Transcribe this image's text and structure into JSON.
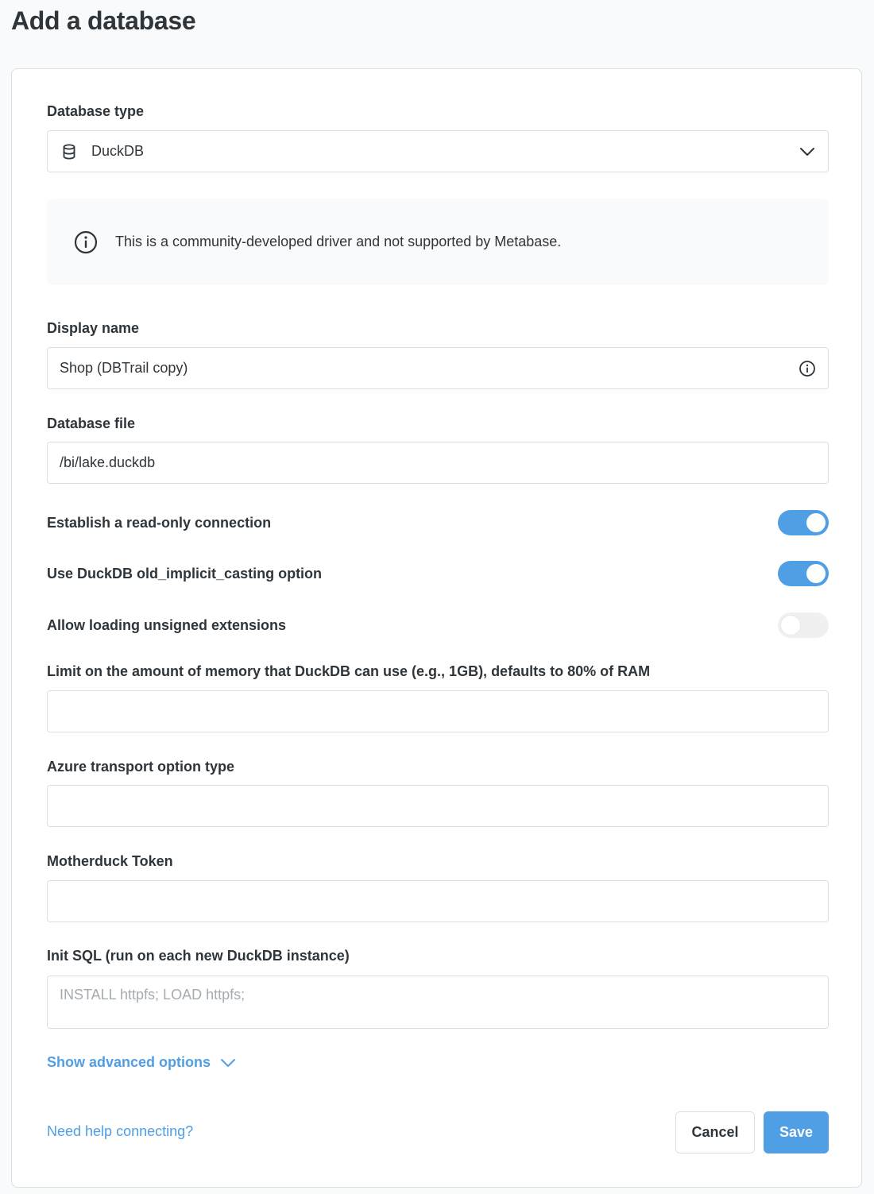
{
  "page": {
    "title": "Add a database"
  },
  "colors": {
    "accent": "#509ee3",
    "border": "#dcdfe0",
    "text": "#2e353b",
    "placeholder": "#a5acb1"
  },
  "form": {
    "database_type": {
      "label": "Database type",
      "value": "DuckDB",
      "icon": "database-icon"
    },
    "notice": {
      "text": "This is a community-developed driver and not supported by Metabase.",
      "icon": "info-icon"
    },
    "display_name": {
      "label": "Display name",
      "value": "Shop (DBTrail copy)"
    },
    "database_file": {
      "label": "Database file",
      "value": "/bi/lake.duckdb"
    },
    "toggles": [
      {
        "label": "Establish a read-only connection",
        "on": true
      },
      {
        "label": "Use DuckDB old_implicit_casting option",
        "on": true
      },
      {
        "label": "Allow loading unsigned extensions",
        "on": false
      }
    ],
    "memory_limit": {
      "label": "Limit on the amount of memory that DuckDB can use (e.g., 1GB), defaults to 80% of RAM",
      "value": ""
    },
    "azure_transport": {
      "label": "Azure transport option type",
      "value": ""
    },
    "motherduck_token": {
      "label": "Motherduck Token",
      "value": ""
    },
    "init_sql": {
      "label": "Init SQL (run on each new DuckDB instance)",
      "value": "",
      "placeholder": "INSTALL httpfs; LOAD httpfs;"
    },
    "advanced_toggle": "Show advanced options",
    "help_link": "Need help connecting?",
    "cancel_label": "Cancel",
    "save_label": "Save"
  }
}
